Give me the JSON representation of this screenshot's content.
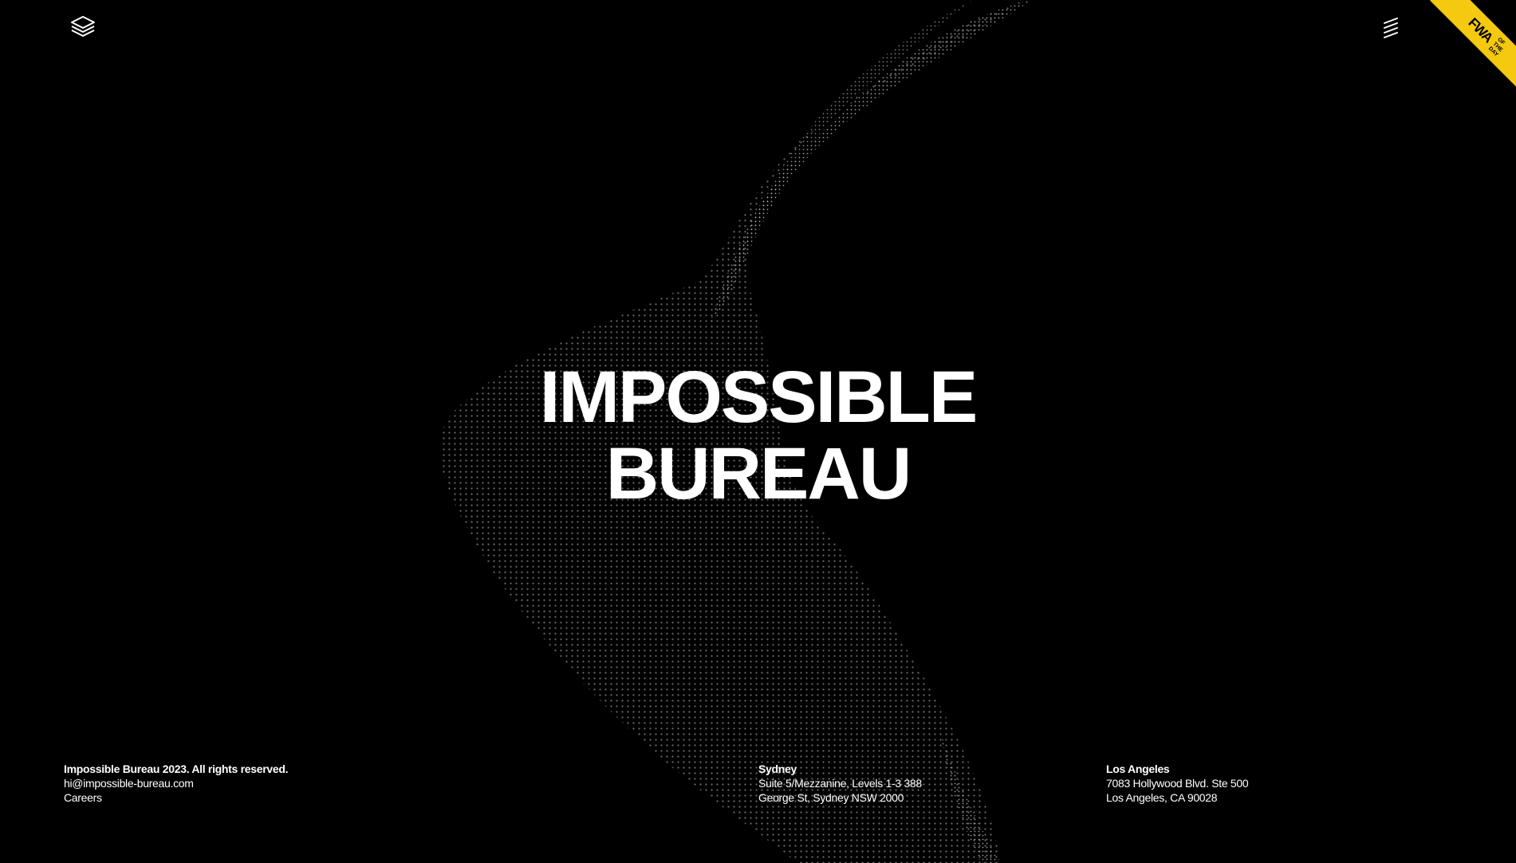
{
  "header": {
    "logo_icon": "stacked-layers-icon",
    "menu_icon": "menu-lines-icon",
    "ribbon": {
      "mark": "FWA",
      "sub": "OF THE DAY",
      "color": "#f4c90f"
    }
  },
  "hero": {
    "line1": "IMPOSSIBLE",
    "line2": "BUREAU"
  },
  "footer": {
    "company": {
      "copyright": "Impossible Bureau 2023. All rights reserved.",
      "email": "hi@impossible-bureau.com",
      "careers": "Careers"
    },
    "sydney": {
      "city": "Sydney",
      "line1": "Suite 5/Mezzanine, Levels 1-3 388",
      "line2": "George St, Sydney NSW 2000"
    },
    "los_angeles": {
      "city": "Los Angeles",
      "line1": "7083 Hollywood Blvd. Ste 500",
      "line2": "Los Angeles, CA 90028"
    }
  },
  "colors": {
    "background": "#000000",
    "text": "#ffffff",
    "particles": "#bdbdbd"
  }
}
